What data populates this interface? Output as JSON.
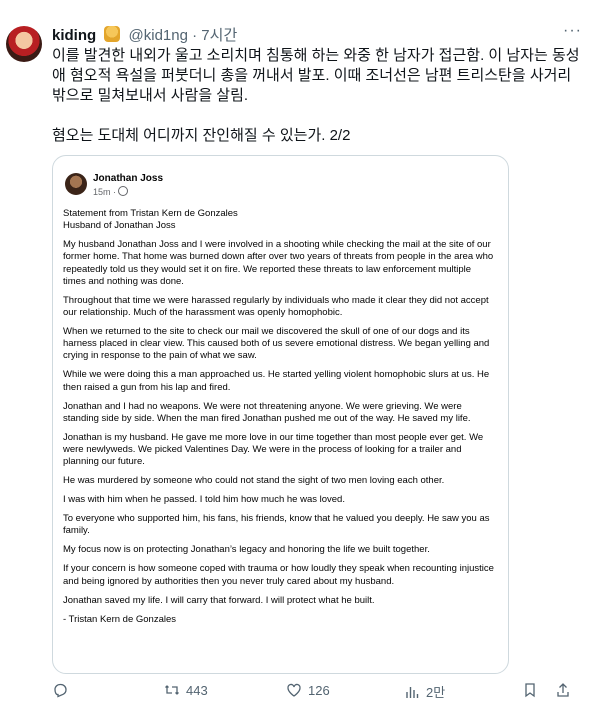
{
  "tweet": {
    "author_name": "kiding",
    "author_handle": "@kid1ng",
    "separator": "·",
    "time": "7시간",
    "more": "···",
    "text_lines": [
      "이를 발견한 내외가 울고 소리치며 침통해 하는 와중 한 남자가 접근함. 이 남자는 동성",
      "애 혐오적 욕설을 퍼붓더니 총을 꺼내서 발포. 이때 조너선은 남편 트리스탄을 사거리",
      "밖으로 밀쳐보내서 사람을 살림."
    ],
    "text_line_2": "혐오는 도대체 어디까지 잔인해질 수 있는가. 2/2"
  },
  "card": {
    "poster_name": "Jonathan Joss",
    "poster_time": "15m ·",
    "paragraphs": [
      "Statement from Tristan Kern de Gonzales\nHusband of Jonathan Joss",
      "My husband Jonathan Joss and I were involved in a shooting while checking the mail at the site of our former home. That home was burned down after over two years of threats from people in the area who repeatedly told us they would set it on fire. We reported these threats to law enforcement multiple times and nothing was done.",
      "Throughout that time we were harassed regularly by individuals who made it clear they did not accept our relationship. Much of the harassment was openly homophobic.",
      "When we returned to the site to check our mail we discovered the skull of one of our dogs and its harness placed in clear view. This caused both of us severe emotional distress. We began yelling and crying in response to the pain of what we saw.",
      "While we were doing this a man approached us. He started yelling violent homophobic slurs at us. He then raised a gun from his lap and fired.",
      "Jonathan and I had no weapons. We were not threatening anyone. We were grieving. We were standing side by side. When the man fired Jonathan pushed me out of the way. He saved my life.",
      "Jonathan is my husband. He gave me more love in our time together than most people ever get. We were newlyweds. We picked Valentines Day. We were in the process of looking for a trailer and planning our future.",
      "He was murdered by someone who could not stand the sight of two men loving each other.",
      "I was with him when he passed. I told him how much he was loved.",
      "To everyone who supported him, his fans, his friends, know that he valued you deeply. He saw you as family.",
      "My focus now is on protecting Jonathan’s legacy and honoring the life we built together.",
      "If your concern is how someone coped with trauma or how loudly they speak when recounting injustice and being ignored by authorities then you never truly cared about my husband.",
      "Jonathan saved my life. I will carry that forward. I will protect what he built.",
      "- Tristan Kern de Gonzales"
    ]
  },
  "actions": {
    "reply_icon": "reply-icon",
    "retweet_icon": "retweet-icon",
    "retweet_count": "443",
    "like_icon": "heart-icon",
    "like_count": "126",
    "views_icon": "views-icon",
    "views_count": "2만",
    "bookmark_icon": "bookmark-icon",
    "share_icon": "share-icon"
  }
}
